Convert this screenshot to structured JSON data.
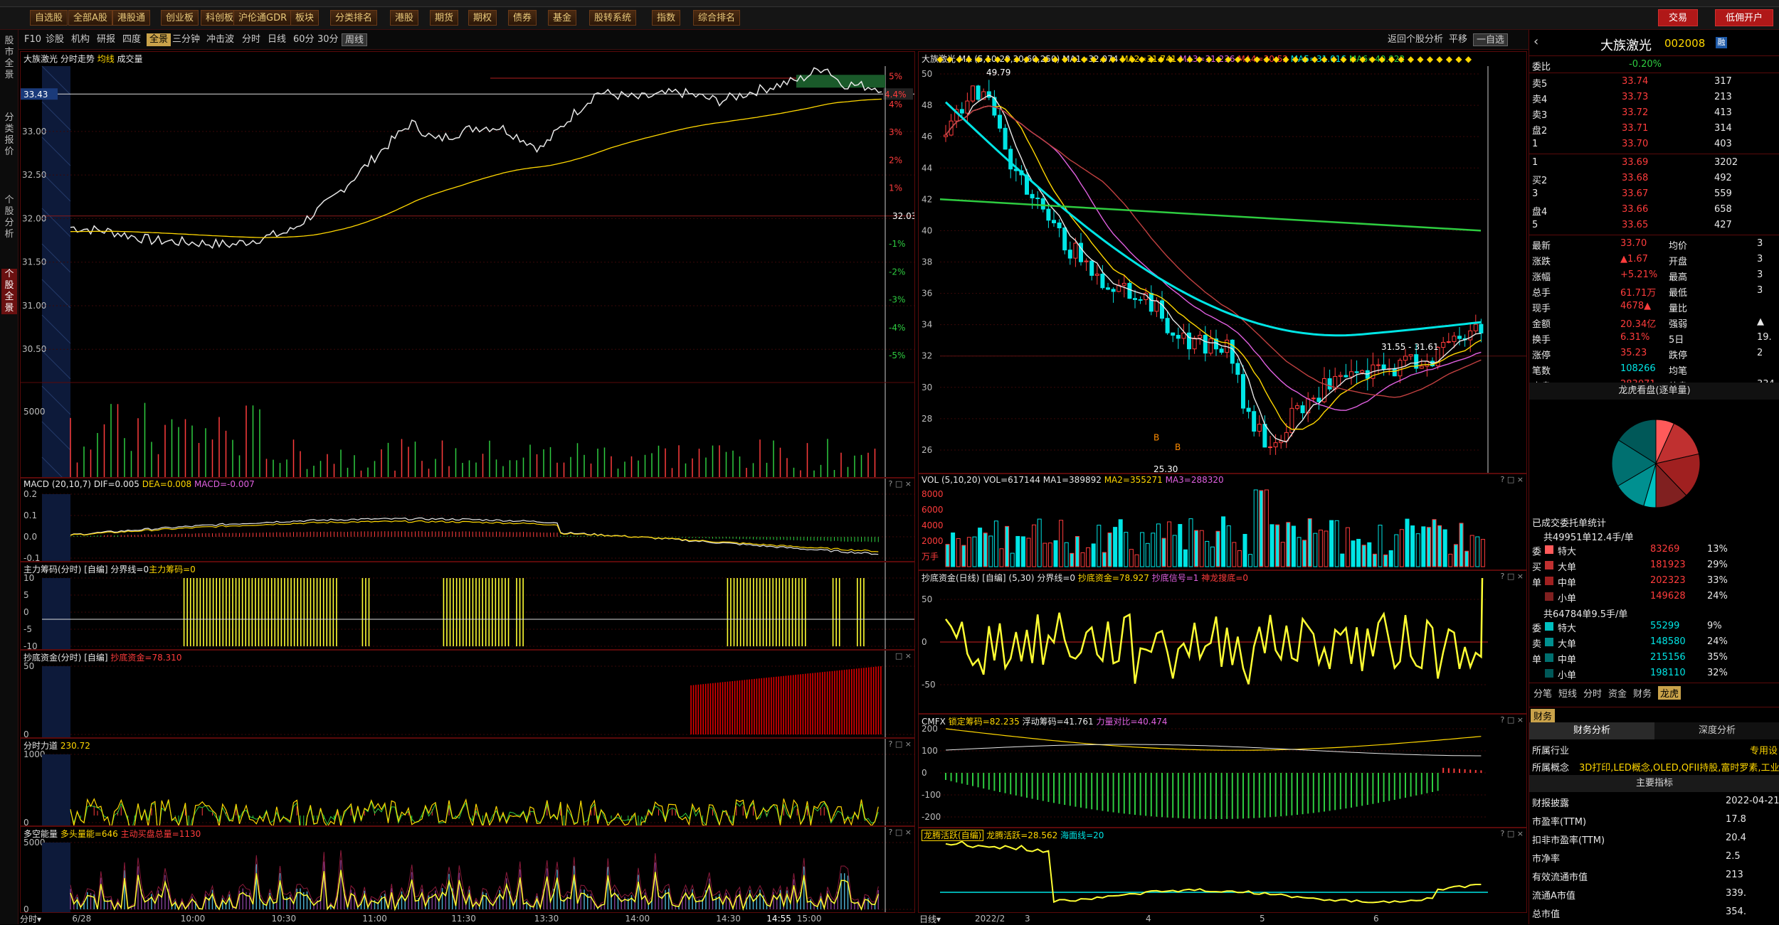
{
  "menu": [
    "自选股",
    "全部A股",
    "港股通",
    "创业板",
    "科创板",
    "沪伦通GDR",
    "板块",
    "分类排名",
    "港股",
    "期货",
    "期权",
    "债券",
    "基金",
    "股转系统",
    "指数",
    "综合排名"
  ],
  "menu_right": [
    "交易",
    "低佣开户"
  ],
  "sidebar": [
    "股市全景",
    "分类报价",
    "个股分析",
    "个股全景"
  ],
  "tabs": [
    "F10",
    "诊股",
    "机构",
    "研报",
    "四度",
    "全景",
    "三分钟",
    "冲击波",
    "分时",
    "日线",
    "60分",
    "30分",
    "周线"
  ],
  "rtabs": [
    "返回个股分析",
    "平移",
    "一自选"
  ],
  "intraday": {
    "title": "大族激光",
    "subtitle": "分时走势",
    "avg_label": "均线",
    "vol_label": "成交量",
    "current_price": "33.43",
    "current_pct": "4.4%",
    "label_3203": "32.03",
    "price_ticks": [
      "33.00",
      "32.50",
      "32.00",
      "31.50",
      "31.00",
      "30.50"
    ],
    "pct_ticks": [
      "5%",
      "4%",
      "3%",
      "2%",
      "1%",
      "-1%",
      "-2%",
      "-3%",
      "-4%",
      "-5%"
    ],
    "vol_tick": "5000",
    "time_ticks": [
      "6/28",
      "10:00",
      "10:30",
      "11:00",
      "11:30",
      "13:30",
      "14:00",
      "14:30",
      "14:55",
      "15:00"
    ],
    "bottom_left": "分时"
  },
  "macd": {
    "name": "MACD",
    "params": "(20,10,7)",
    "dif": "DIF=0.005",
    "dea": "DEA=0.008",
    "macd": "MACD=-0.007",
    "ticks": [
      "0.2",
      "0.1",
      "0.0",
      "-0.1"
    ]
  },
  "zlcm": {
    "name": "主力筹码(分时)",
    "edit": "[自编]",
    "line": "分界线=0",
    "val": "主力筹码=0",
    "ticks": [
      "10",
      "5",
      "0",
      "-5",
      "-10"
    ]
  },
  "cdzj": {
    "name": "抄底资金(分时)",
    "edit": "[自编]",
    "val": "抄底资金=78.310",
    "ticks": [
      "50",
      "0"
    ]
  },
  "fsll": {
    "name": "分时力道",
    "val": "230.72",
    "ticks": [
      "1000",
      "0"
    ]
  },
  "dkn": {
    "name": "多空能量",
    "a": "多头量能=646",
    "b": "主动买盘总量=1130",
    "ticks": [
      "5000",
      "0"
    ]
  },
  "kline": {
    "title": "大族激光",
    "ma": "MA",
    "params": "(5,10,20,30,60,250)",
    "ma1": "MA1=32.074",
    "ma2": "MA2=31.741",
    "ma3": "MA3=31.236",
    "ma4": "MA4=30.52",
    "ma5": "MA5=31.016",
    "ma6": "MA6=40.022",
    "ticks": [
      "50",
      "48",
      "46",
      "44",
      "42",
      "40",
      "38",
      "36",
      "34",
      "32",
      "30",
      "28",
      "26"
    ],
    "hi": "49.79",
    "lo": "25.30",
    "range": "31.55 - 31.61",
    "b1": "B",
    "b2": "B",
    "date_ticks": [
      "2022/2",
      "3",
      "4",
      "5",
      "6"
    ],
    "bottom_left": "日线"
  },
  "vol": {
    "name": "VOL",
    "params": "(5,10,20)",
    "v": "VOL=617144",
    "ma1": "MA1=389892",
    "ma2": "MA2=355271",
    "ma3": "MA3=288320",
    "ticks": [
      "8000",
      "6000",
      "4000",
      "2000",
      "万手"
    ]
  },
  "cdzj2": {
    "name": "抄底资金(日线)",
    "edit": "[自编]",
    "params": "(5,30)",
    "line": "分界线=0",
    "val": "抄底资金=78.927",
    "sig": "抄底信号=1",
    "sl": "神龙搜底=0",
    "ticks": [
      "50",
      "0",
      "-50"
    ]
  },
  "cmfx": {
    "name": "CMFX",
    "a": "锁定筹码=82.235",
    "b": "浮动筹码=41.761",
    "c": "力量对比=40.474",
    "ticks": [
      "200",
      "100",
      "0",
      "-100",
      "-200"
    ]
  },
  "ltr": {
    "name": "龙腾活跃(自编)",
    "a": "龙腾活跃=28.562",
    "b": "海面线=20"
  },
  "info": {
    "name": "大族激光",
    "code": "002008",
    "weibi_label": "委比",
    "weibi": "-0.20%",
    "sell": [
      [
        "卖5",
        "33.74",
        "317"
      ],
      [
        "卖4",
        "33.73",
        "213"
      ],
      [
        "卖3",
        "33.72",
        "413"
      ],
      [
        "盘2",
        "33.71",
        "314"
      ],
      [
        "1",
        "33.70",
        "403"
      ]
    ],
    "buy": [
      [
        "1",
        "33.69",
        "3202"
      ],
      [
        "买2",
        "33.68",
        "492"
      ],
      [
        "3",
        "33.67",
        "559"
      ],
      [
        "盘4",
        "33.66",
        "658"
      ],
      [
        "5",
        "33.65",
        "427"
      ]
    ],
    "stats": [
      [
        "最新",
        "33.70",
        "均价",
        "3"
      ],
      [
        "涨跌",
        "▲1.67",
        "开盘",
        "3"
      ],
      [
        "涨幅",
        "+5.21%",
        "最高",
        "3"
      ],
      [
        "总手",
        "61.71万",
        "最低",
        "3"
      ],
      [
        "现手",
        "4678▲",
        "量比",
        ""
      ],
      [
        "金额",
        "20.34亿",
        "强弱",
        "▲"
      ],
      [
        "换手",
        "6.31%",
        "5日",
        "19."
      ],
      [
        "涨停",
        "35.23",
        "跌停",
        "2"
      ],
      [
        "笔数",
        "108266",
        "均笔",
        ""
      ],
      [
        "内盘",
        "283071",
        "外盘",
        "334"
      ]
    ],
    "lhk": "龙虎看盘(逐单量)",
    "deal_label": "已成交委托单统计",
    "buy_total": "共49951单12.4手/单",
    "buy_rows": [
      [
        "委",
        "特大",
        "83269",
        "13%"
      ],
      [
        "买",
        "大单",
        "181923",
        "29%"
      ],
      [
        "单",
        "中单",
        "202323",
        "33%"
      ],
      [
        "",
        "小单",
        "149628",
        "24%"
      ]
    ],
    "sell_total": "共64784单9.5手/单",
    "sell_rows": [
      [
        "委",
        "特大",
        "55299",
        "9%"
      ],
      [
        "卖",
        "大单",
        "148580",
        "24%"
      ],
      [
        "单",
        "中单",
        "215156",
        "35%"
      ],
      [
        "",
        "小单",
        "198110",
        "32%"
      ]
    ],
    "subtabs": [
      "分笔",
      "短线",
      "分时",
      "资金",
      "财务",
      "龙虎"
    ],
    "fin_tab": "财务",
    "fin_subtabs": [
      "财务分析",
      "深度分析"
    ],
    "industry_label": "所属行业",
    "industry": "专用设",
    "concept_label": "所属概念",
    "concept": "3D打印,LED概念,OLED,QFII持股,富时罗素,工业",
    "main_idx": "主要指标",
    "fin": [
      [
        "财报披露",
        "2022-04-21"
      ],
      [
        "市盈率(TTM)",
        "17.8"
      ],
      [
        "扣非市盈率(TTM)",
        "20.4"
      ],
      [
        "市净率",
        "2.5"
      ],
      [
        "有效流通市值",
        "213"
      ],
      [
        "流通A市值",
        "339."
      ],
      [
        "总市值",
        "354."
      ]
    ]
  },
  "colors": {
    "up": "#ff3c3c",
    "down": "#00e5e5",
    "panel_border": "#5a0a0a",
    "ma_yellow": "#ffd700"
  }
}
